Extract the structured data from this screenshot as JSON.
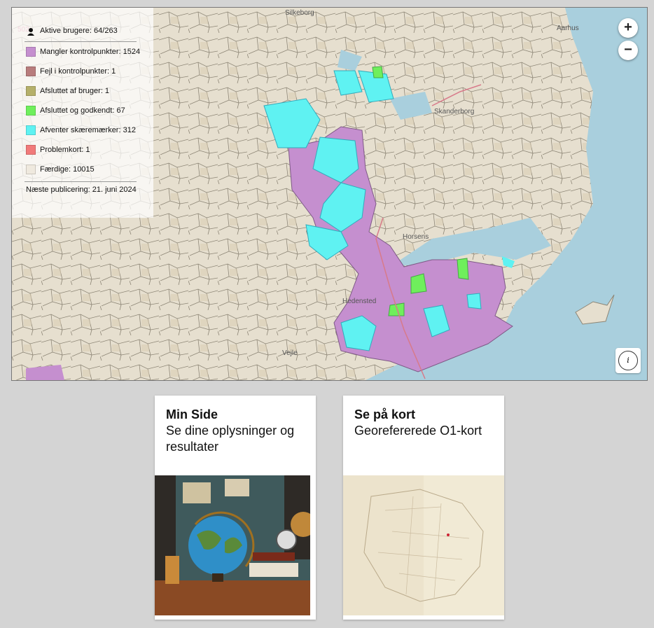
{
  "map": {
    "place_labels": [
      "Silkeborg",
      "Skanderborg",
      "Horsens",
      "Hedensted",
      "Vejle",
      "Aarhus"
    ],
    "top_left_code": "502",
    "legend": {
      "active_users": "Aktive brugere: 64/263",
      "items": [
        {
          "label": "Mangler kontrolpunkter: 1524",
          "color": "#c58fcf"
        },
        {
          "label": "Fejl i kontrolpunkter: 1",
          "color": "#b87c7c"
        },
        {
          "label": "Afsluttet af bruger: 1",
          "color": "#b5b06a"
        },
        {
          "label": "Afsluttet og godkendt: 67",
          "color": "#6fef5c"
        },
        {
          "label": "Afventer skæremærker: 312",
          "color": "#5ff2f2"
        },
        {
          "label": "Problemkort: 1",
          "color": "#f17a7a"
        },
        {
          "label": "Færdige: 10015",
          "color": "#efe9de"
        }
      ],
      "publication": "Næste publicering: 21. juni 2024"
    },
    "zoom_in": "+",
    "zoom_out": "−",
    "info": "i"
  },
  "cards": [
    {
      "title": "Min Side",
      "subtitle": "Se dine oplysninger og resultater",
      "image": "globe-desk-illustration"
    },
    {
      "title": "Se på kort",
      "subtitle": "Georefererede O1-kort",
      "image": "old-map-scan"
    }
  ]
}
